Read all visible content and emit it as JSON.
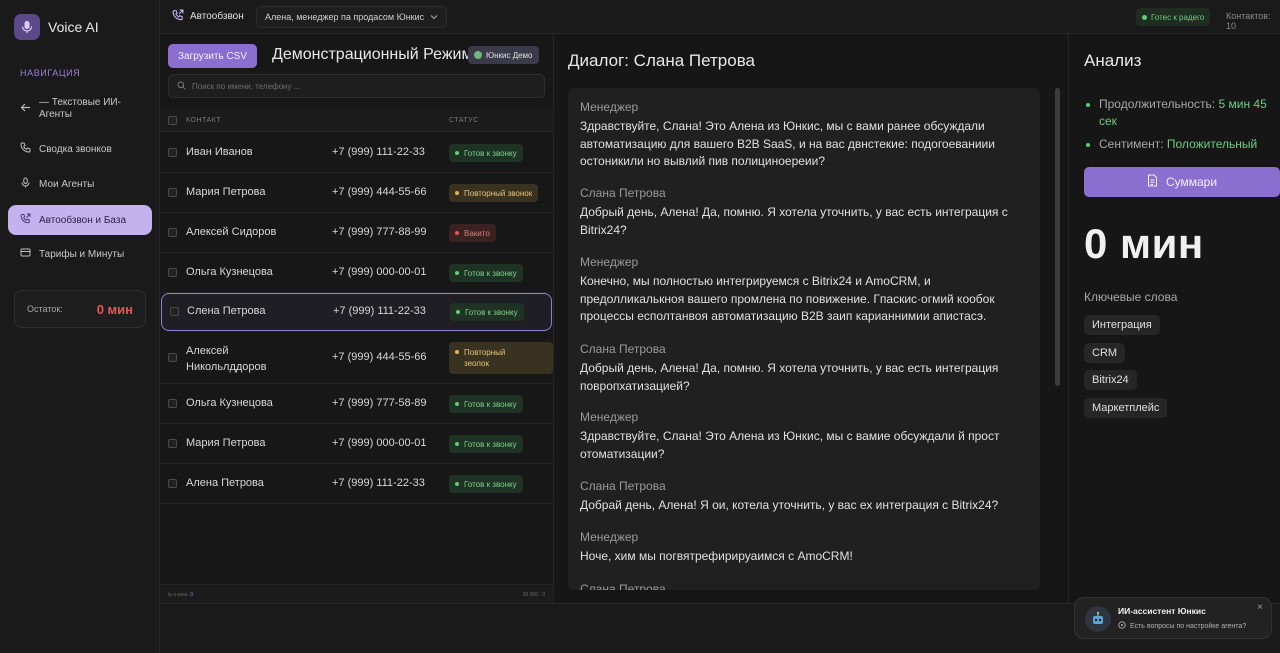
{
  "brand": {
    "name": "Voice AI"
  },
  "sidebar": {
    "heading": "НАВИГАЦИЯ",
    "items": [
      {
        "label": "— Текстовые ИИ-Агенты",
        "icon": "arrow-left-icon"
      },
      {
        "label": "Сводка звонков",
        "icon": "phone-icon"
      },
      {
        "label": "Мои Агенты",
        "icon": "microphone-icon"
      },
      {
        "label": "Автообзвон и База",
        "icon": "phone-outgoing-icon",
        "active": true
      },
      {
        "label": "Тарифы и Минуты",
        "icon": "card-icon"
      }
    ],
    "balance": {
      "label": "Остаток:",
      "value": "0 мин"
    }
  },
  "topbar": {
    "title": "Автообзвон",
    "agent_select": "Алена, менеджер па продасом Юнкис",
    "status": "Готес к радего",
    "contacts_label": "Контактов: 10"
  },
  "contacts": {
    "upload_button": "Загрузить CSV",
    "mode_title": "Демонстрационный Режим",
    "demo_badge": "Юнкис Демо",
    "search_placeholder": "Поиск по имени, телефону ...",
    "headers": {
      "contact": "КОНТАКТ",
      "status": "СТАТУС"
    },
    "rows": [
      {
        "name": "Иван Иванов",
        "phone": "+7 (999) 111-22-33",
        "status": "Готов к звонку",
        "kind": "ready"
      },
      {
        "name": "Мария Петрова",
        "phone": "+7 (999) 444-55-66",
        "status": "Повторный звонок",
        "kind": "repeat"
      },
      {
        "name": "Алексей Сидоров",
        "phone": "+7 (999) 777-88-99",
        "status": "Вакито",
        "kind": "busy"
      },
      {
        "name": "Ольга Кузнецова",
        "phone": "+7 (999) 000-00-01",
        "status": "Готов к звонку",
        "kind": "ready"
      },
      {
        "name": "Слена Петрова",
        "phone": "+7 (999) 111-22-33",
        "status": "Готов к звонку",
        "kind": "ready",
        "selected": true
      },
      {
        "name": "Алексей Никольлддоров",
        "phone": "+7 (999) 444-55-66",
        "status": "Повторный зеолок",
        "kind": "repeat"
      },
      {
        "name": "Ольга Кузнецова",
        "phone": "+7 (999) 777-58-89",
        "status": "Готов к звонку",
        "kind": "ready"
      },
      {
        "name": "Мария Петрова",
        "phone": "+7 (999) 000-00-01",
        "status": "Готов к звонку",
        "kind": "ready"
      },
      {
        "name": "Алена Петрова",
        "phone": "+7 (999) 111-22-33",
        "status": "Готов к звонку",
        "kind": "ready"
      }
    ],
    "footer": {
      "left_label": "ty-o-peiu:",
      "left_value": "0",
      "right": "00.006 : 0"
    }
  },
  "dialog": {
    "title": "Диалог: Слана Петрова",
    "messages": [
      {
        "speaker": "Менеджер",
        "text": "Здравствуйте, Слана! Это Алена из Юнкис, мы с вами ранее обсуждали автоматизацию для вашего B2B SaaS, и на вас двнстекие: подогоеваниии остоникили но вывлий пив полициноереии?"
      },
      {
        "speaker": "Слана Петрова",
        "text": "Добрый день, Алена! Да, помню. Я хотела уточнить, у вас есть интеграция с Bitrix24?"
      },
      {
        "speaker": "Менеджер",
        "text": "Конечно, мы полностью интегрируемся с Bitrix24 и AmoCRM, и предолликалькноя вашего промлена по повижение. Гпаскис·огмий кообок процессы есполтанвоя автоматизацию B2B заип карианнимии апистасэ."
      },
      {
        "speaker": "Слана Петрова",
        "text": "Добрый день, Алена! Да, помню. Я хотела уточнить, у вас есть интеграция повропхатизацией?"
      },
      {
        "speaker": "Менеджер",
        "text": "Здравствуйте, Слана! Это Алена из Юнкис, мы с вамие обсуждали й прост отоматизации?"
      },
      {
        "speaker": "Слана Петрова",
        "text": "Добрай день, Алена! Я ои, котела уточнить, у вас ех интеграция с Bitrix24?"
      },
      {
        "speaker": "Менеджер",
        "text": "Ноче, хим мы погвятрефирируаимся с AmoCRM!"
      },
      {
        "speaker": "Слана Петрова",
        "text": ""
      }
    ]
  },
  "analysis": {
    "title": "Анализ",
    "duration_label": "Продолжительность:",
    "duration_value": "5 мин 45 сек",
    "sentiment_label": "Сентимент:",
    "sentiment_value": "Положительный",
    "summary_button": "Суммари",
    "total_minutes": "0 мин",
    "keywords_title": "Ключевые слова",
    "keywords": [
      "Интеграция",
      "CRM",
      "Bitrix24",
      "Маркетплейс"
    ]
  },
  "assistant": {
    "title": "ИИ-ассистент Юнкис",
    "subtitle": "Есть вопросы по настройке агента?",
    "close": "×"
  },
  "colors": {
    "accent": "#8a6fd0",
    "ready": "#5fcf75",
    "repeat": "#e6b34a",
    "busy": "#e55656"
  }
}
